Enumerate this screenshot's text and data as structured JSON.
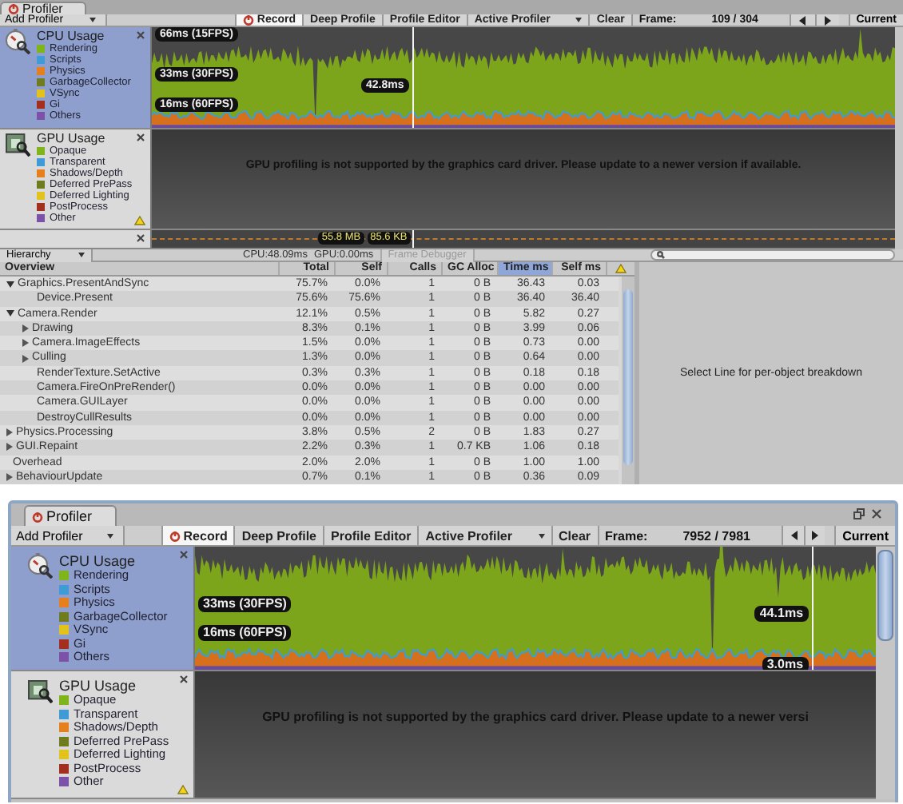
{
  "windows": [
    {
      "tab": {
        "label": "Profiler"
      },
      "toolbar": {
        "add_profiler": "Add Profiler",
        "buttons": [
          {
            "label": "Record",
            "kind": "record",
            "selected": true
          },
          {
            "label": "Deep Profile",
            "kind": "toggle",
            "selected": false
          },
          {
            "label": "Profile Editor",
            "kind": "toggle",
            "selected": false
          },
          {
            "label": "Active Profiler",
            "kind": "dropdown",
            "selected": false
          },
          {
            "label": "Clear",
            "kind": "toggle",
            "selected": false
          }
        ],
        "frame_label": "Frame:",
        "frame_value": "109 / 304",
        "current": "Current"
      },
      "areas": [
        {
          "kind": "cpu",
          "title": "CPU Usage",
          "selected": true,
          "legend": [
            {
              "label": "Rendering",
              "color": "#7fb51a"
            },
            {
              "label": "Scripts",
              "color": "#3e9bd6"
            },
            {
              "label": "Physics",
              "color": "#e6801f"
            },
            {
              "label": "GarbageCollector",
              "color": "#6f7b1e"
            },
            {
              "label": "VSync",
              "color": "#e2c21c"
            },
            {
              "label": "Gi",
              "color": "#a3301e"
            },
            {
              "label": "Others",
              "color": "#7b52a8"
            }
          ],
          "markers": [
            "66ms (15FPS)",
            "33ms (30FPS)",
            "16ms (60FPS)"
          ],
          "readings": [
            "42.8ms"
          ]
        },
        {
          "kind": "gpu",
          "title": "GPU Usage",
          "selected": false,
          "warning": true,
          "legend": [
            {
              "label": "Opaque",
              "color": "#7fb51a"
            },
            {
              "label": "Transparent",
              "color": "#3e9bd6"
            },
            {
              "label": "Shadows/Depth",
              "color": "#e6801f"
            },
            {
              "label": "Deferred PrePass",
              "color": "#6f7b1e"
            },
            {
              "label": "Deferred Lighting",
              "color": "#e2c21c"
            },
            {
              "label": "PostProcess",
              "color": "#a3301e"
            },
            {
              "label": "Other",
              "color": "#7b52a8"
            }
          ],
          "message": "GPU profiling is not supported by the graphics card driver. Please update to a newer version if available."
        },
        {
          "kind": "memory",
          "selected": false,
          "readings": [
            "55.8 MB",
            "85.6 KB"
          ]
        }
      ],
      "hierarchy": {
        "view": "Hierarchy",
        "cpu_time": "CPU:48.09ms",
        "gpu_time": "GPU:0.00ms",
        "frame_debugger": {
          "label": "Frame Debugger",
          "disabled": true
        },
        "columns": [
          {
            "label": "Overview",
            "selected": false
          },
          {
            "label": "Total",
            "selected": false
          },
          {
            "label": "Self",
            "selected": false
          },
          {
            "label": "Calls",
            "selected": false
          },
          {
            "label": "GC Alloc",
            "selected": false
          },
          {
            "label": "Time ms",
            "selected": true
          },
          {
            "label": "Self ms",
            "selected": false
          }
        ],
        "rows": [
          {
            "kind": "node",
            "expanded": true,
            "cells": [
              "Graphics.PresentAndSync",
              "75.7%",
              "0.0%",
              "1",
              "0 B",
              "36.43",
              "0.03"
            ],
            "children": [
              {
                "kind": "leaf",
                "cells": [
                  "Device.Present",
                  "75.6%",
                  "75.6%",
                  "1",
                  "0 B",
                  "36.40",
                  "36.40"
                ]
              }
            ]
          },
          {
            "kind": "node",
            "expanded": true,
            "cells": [
              "Camera.Render",
              "12.1%",
              "0.5%",
              "1",
              "0 B",
              "5.82",
              "0.27"
            ],
            "children": [
              {
                "kind": "node",
                "expanded": false,
                "cells": [
                  "Drawing",
                  "8.3%",
                  "0.1%",
                  "1",
                  "0 B",
                  "3.99",
                  "0.06"
                ]
              },
              {
                "kind": "node",
                "expanded": false,
                "cells": [
                  "Camera.ImageEffects",
                  "1.5%",
                  "0.0%",
                  "1",
                  "0 B",
                  "0.73",
                  "0.00"
                ]
              },
              {
                "kind": "node",
                "expanded": false,
                "cells": [
                  "Culling",
                  "1.3%",
                  "0.0%",
                  "1",
                  "0 B",
                  "0.64",
                  "0.00"
                ]
              },
              {
                "kind": "leaf",
                "cells": [
                  "RenderTexture.SetActive",
                  "0.3%",
                  "0.3%",
                  "1",
                  "0 B",
                  "0.18",
                  "0.18"
                ]
              },
              {
                "kind": "leaf",
                "cells": [
                  "Camera.FireOnPreRender()",
                  "0.0%",
                  "0.0%",
                  "1",
                  "0 B",
                  "0.00",
                  "0.00"
                ]
              },
              {
                "kind": "leaf",
                "cells": [
                  "Camera.GUILayer",
                  "0.0%",
                  "0.0%",
                  "1",
                  "0 B",
                  "0.00",
                  "0.00"
                ]
              },
              {
                "kind": "leaf",
                "cells": [
                  "DestroyCullResults",
                  "0.0%",
                  "0.0%",
                  "1",
                  "0 B",
                  "0.00",
                  "0.00"
                ]
              }
            ]
          },
          {
            "kind": "node",
            "expanded": false,
            "cells": [
              "Physics.Processing",
              "3.8%",
              "0.5%",
              "2",
              "0 B",
              "1.83",
              "0.27"
            ]
          },
          {
            "kind": "node",
            "expanded": false,
            "cells": [
              "GUI.Repaint",
              "2.2%",
              "0.3%",
              "1",
              "0.7 KB",
              "1.06",
              "0.18"
            ]
          },
          {
            "kind": "leaf",
            "cells": [
              "Overhead",
              "2.0%",
              "2.0%",
              "1",
              "0 B",
              "1.00",
              "1.00"
            ]
          },
          {
            "kind": "node",
            "expanded": false,
            "cells": [
              "BehaviourUpdate",
              "0.7%",
              "0.1%",
              "1",
              "0 B",
              "0.36",
              "0.09"
            ]
          }
        ],
        "detail_message": "Select Line for per-object breakdown"
      }
    },
    {
      "tab": {
        "label": "Profiler"
      },
      "toolbar": {
        "add_profiler": "Add Profiler",
        "buttons": [
          {
            "label": "Record",
            "kind": "record",
            "selected": true
          },
          {
            "label": "Deep Profile",
            "kind": "toggle",
            "selected": false
          },
          {
            "label": "Profile Editor",
            "kind": "toggle",
            "selected": false
          },
          {
            "label": "Active Profiler",
            "kind": "dropdown",
            "selected": false
          },
          {
            "label": "Clear",
            "kind": "toggle",
            "selected": false
          }
        ],
        "frame_label": "Frame:",
        "frame_value": "7952 / 7981",
        "current": "Current"
      },
      "areas": [
        {
          "kind": "cpu",
          "title": "CPU Usage",
          "selected": true,
          "legend": [
            {
              "label": "Rendering",
              "color": "#7fb51a"
            },
            {
              "label": "Scripts",
              "color": "#3e9bd6"
            },
            {
              "label": "Physics",
              "color": "#e6801f"
            },
            {
              "label": "GarbageCollector",
              "color": "#6f7b1e"
            },
            {
              "label": "VSync",
              "color": "#e2c21c"
            },
            {
              "label": "Gi",
              "color": "#a3301e"
            },
            {
              "label": "Others",
              "color": "#7b52a8"
            }
          ],
          "markers": [
            "33ms (30FPS)",
            "16ms (60FPS)"
          ],
          "readings": [
            "44.1ms",
            "3.0ms"
          ]
        },
        {
          "kind": "gpu",
          "title": "GPU Usage",
          "selected": false,
          "warning": true,
          "legend": [
            {
              "label": "Opaque",
              "color": "#7fb51a"
            },
            {
              "label": "Transparent",
              "color": "#3e9bd6"
            },
            {
              "label": "Shadows/Depth",
              "color": "#e6801f"
            },
            {
              "label": "Deferred PrePass",
              "color": "#6f7b1e"
            },
            {
              "label": "Deferred Lighting",
              "color": "#e2c21c"
            },
            {
              "label": "PostProcess",
              "color": "#a3301e"
            },
            {
              "label": "Other",
              "color": "#7b52a8"
            }
          ],
          "message": "GPU profiling is not supported by the graphics card driver. Please update to a newer versi"
        }
      ]
    }
  ]
}
